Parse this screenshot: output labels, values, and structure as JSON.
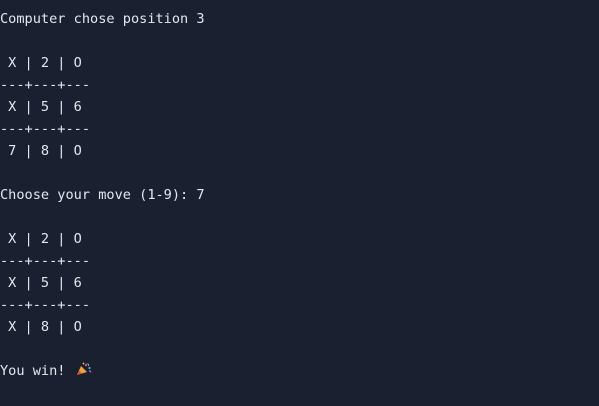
{
  "terminal": {
    "lines": [
      "Computer chose position 3",
      "",
      " X | 2 | O",
      "---+---+---",
      " X | 5 | 6",
      "---+---+---",
      " 7 | 8 | O",
      "",
      "Choose your move (1-9): 7",
      "",
      " X | 2 | O",
      "---+---+---",
      " X | 5 | 6",
      "---+---+---",
      " X | 8 | O",
      "",
      "You win! "
    ],
    "win_icon": "party-popper-icon"
  }
}
